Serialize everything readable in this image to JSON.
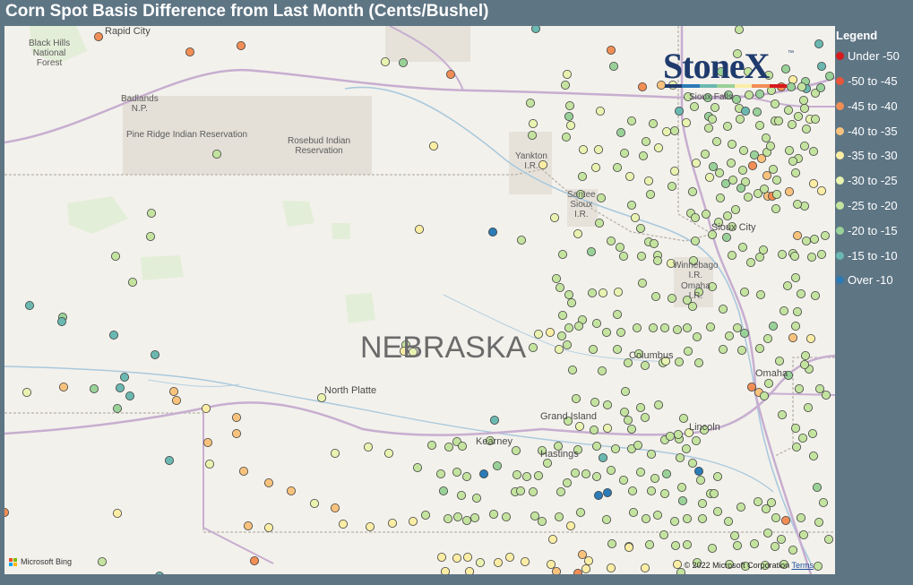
{
  "title": "Corn Spot Basis Difference from Last Month (Cents/Bushel)",
  "legend": {
    "title": "Legend",
    "items": [
      {
        "label": "Under -50",
        "color": "#d7191c"
      },
      {
        "label": "-50 to -45",
        "color": "#e8553a"
      },
      {
        "label": "-45 to -40",
        "color": "#f08e55"
      },
      {
        "label": "-40 to -35",
        "color": "#f8c27d"
      },
      {
        "label": "-35 to -30",
        "color": "#fbeda4"
      },
      {
        "label": "-30 to -25",
        "color": "#e8f3b0"
      },
      {
        "label": "-25 to -20",
        "color": "#c3e39f"
      },
      {
        "label": "-20 to -15",
        "color": "#99d198"
      },
      {
        "label": "-15 to -10",
        "color": "#6ab8b0"
      },
      {
        "label": "Over -10",
        "color": "#2c7bb6"
      }
    ]
  },
  "map": {
    "state_label": "NEBRASKA",
    "places": [
      "Rapid City",
      "Black Hills National Forest",
      "Badlands N.P.",
      "Pine Ridge Indian Reservation",
      "Rosebud Indian Reservation",
      "Yankton I.R.",
      "Santee Sioux I.R.",
      "Sioux City",
      "Winnebago I.R.",
      "Omaha I.R.",
      "Columbus",
      "Omaha",
      "North Platte",
      "Grand Island",
      "Kearney",
      "Hastings",
      "Lincoln",
      "Sioux Falls"
    ]
  },
  "branding": {
    "logo": "StoneX",
    "trademark": "™"
  },
  "attribution": {
    "provider": "Microsoft Bing",
    "copyright": "© 2022 Microsoft Corporation",
    "terms": "Terms"
  }
}
